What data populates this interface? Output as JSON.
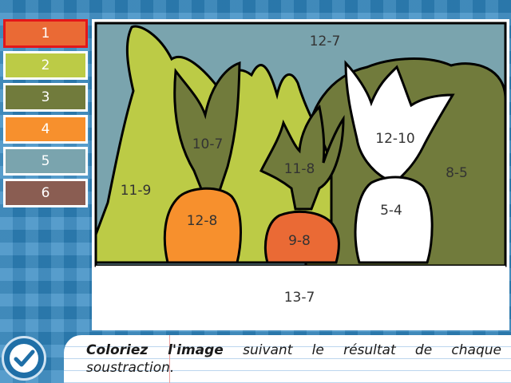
{
  "palette": {
    "swatches": [
      {
        "label": "1",
        "color": "#ea6a35",
        "selected": true
      },
      {
        "label": "2",
        "color": "#bccb46",
        "selected": false
      },
      {
        "label": "3",
        "color": "#717b3c",
        "selected": false
      },
      {
        "label": "4",
        "color": "#f7902d",
        "selected": false
      },
      {
        "label": "5",
        "color": "#7aa4ae",
        "selected": false
      },
      {
        "label": "6",
        "color": "#8a5d52",
        "selected": false
      }
    ],
    "selection_border_color": "#e3161a"
  },
  "canvas": {
    "regions": {
      "sky": "12-7",
      "right_bush_top": "12-10",
      "right_bush": "8-5",
      "left_foliage": "11-9",
      "left_leaves": "10-7",
      "middle_leaves": "11-8",
      "left_carrot": "12-8",
      "middle_carrot": "9-8",
      "radish": "5-4",
      "ground": "13-7"
    }
  },
  "instruction": {
    "bold": "Coloriez l'image",
    "rest": " suivant le résultat de chaque soustraction."
  },
  "check_icon": "checkmark-icon"
}
